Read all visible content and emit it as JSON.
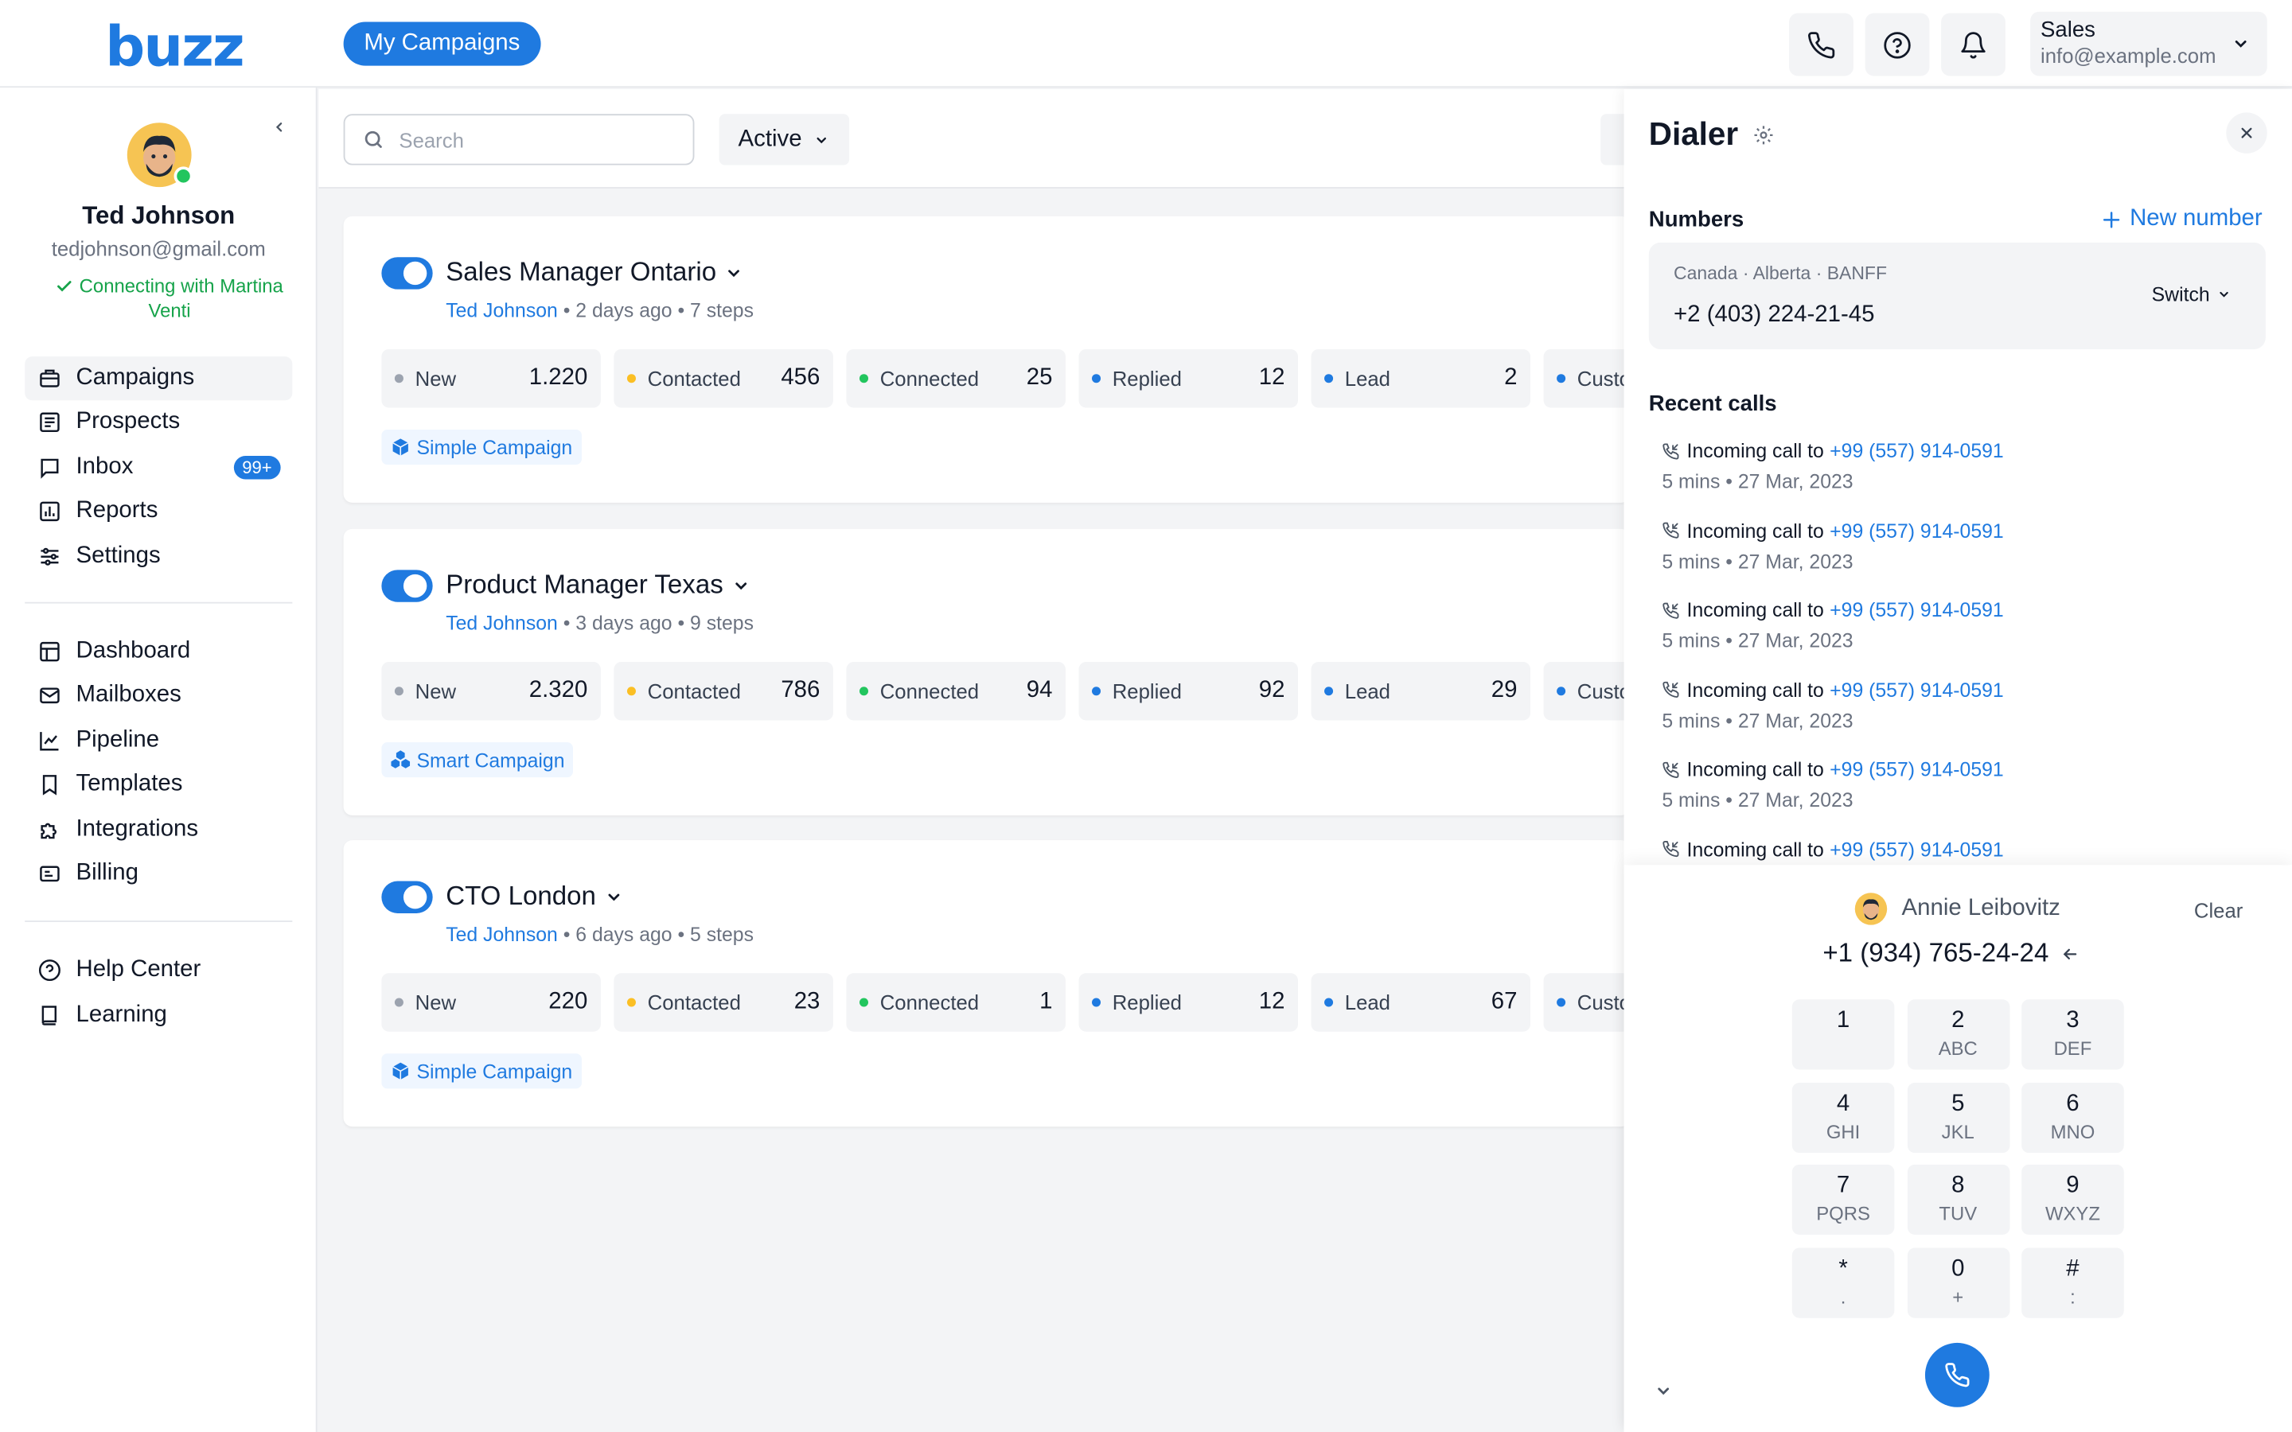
{
  "header": {
    "logo": "buzz",
    "campaigns_pill": "My Campaigns",
    "account": {
      "name": "Sales",
      "email": "info@example.com"
    },
    "icons": [
      "phone-icon",
      "help-icon",
      "bell-icon",
      "chevron-down-icon"
    ]
  },
  "user": {
    "name": "Ted Johnson",
    "email": "tedjohnson@gmail.com",
    "status": "Connecting with Martina Venti"
  },
  "sidebar": {
    "primary": [
      {
        "label": "Campaigns",
        "icon": "campaigns-icon",
        "active": true
      },
      {
        "label": "Prospects",
        "icon": "prospects-icon"
      },
      {
        "label": "Inbox",
        "icon": "inbox-icon",
        "badge": "99+"
      },
      {
        "label": "Reports",
        "icon": "reports-icon"
      },
      {
        "label": "Settings",
        "icon": "settings-icon"
      }
    ],
    "secondary": [
      {
        "label": "Dashboard",
        "icon": "dashboard-icon"
      },
      {
        "label": "Mailboxes",
        "icon": "mail-icon"
      },
      {
        "label": "Pipeline",
        "icon": "pipeline-icon"
      },
      {
        "label": "Templates",
        "icon": "bookmark-icon"
      },
      {
        "label": "Integrations",
        "icon": "puzzle-icon"
      },
      {
        "label": "Billing",
        "icon": "billing-icon"
      }
    ],
    "tertiary": [
      {
        "label": "Help Center",
        "icon": "help-icon"
      },
      {
        "label": "Learning",
        "icon": "book-icon"
      }
    ]
  },
  "toolbar": {
    "search_placeholder": "Search",
    "filter": "Active"
  },
  "campaigns": [
    {
      "title": "Sales Manager Ontario",
      "owner": "Ted Johnson",
      "meta": " • 2 days ago • 7 steps",
      "stats": [
        {
          "label": "New",
          "value": "1.220",
          "color": "#9ca3af"
        },
        {
          "label": "Contacted",
          "value": "456",
          "color": "#fbbf24"
        },
        {
          "label": "Connected",
          "value": "25",
          "color": "#22c55e"
        },
        {
          "label": "Replied",
          "value": "12",
          "color": "#1f7ae0"
        },
        {
          "label": "Lead",
          "value": "2",
          "color": "#1f7ae0"
        },
        {
          "label": "Custo",
          "value": "",
          "color": "#1f7ae0"
        }
      ],
      "tag": "Simple Campaign",
      "tag_icon": "cube-icon"
    },
    {
      "title": "Product Manager Texas",
      "owner": "Ted Johnson",
      "meta": " • 3 days ago • 9 steps",
      "stats": [
        {
          "label": "New",
          "value": "2.320",
          "color": "#9ca3af"
        },
        {
          "label": "Contacted",
          "value": "786",
          "color": "#fbbf24"
        },
        {
          "label": "Connected",
          "value": "94",
          "color": "#22c55e"
        },
        {
          "label": "Replied",
          "value": "92",
          "color": "#1f7ae0"
        },
        {
          "label": "Lead",
          "value": "29",
          "color": "#1f7ae0"
        },
        {
          "label": "Custo",
          "value": "",
          "color": "#1f7ae0"
        }
      ],
      "tag": "Smart Campaign",
      "tag_icon": "cubes-icon"
    },
    {
      "title": "CTO London",
      "owner": "Ted Johnson",
      "meta": " • 6 days ago • 5 steps",
      "stats": [
        {
          "label": "New",
          "value": "220",
          "color": "#9ca3af"
        },
        {
          "label": "Contacted",
          "value": "23",
          "color": "#fbbf24"
        },
        {
          "label": "Connected",
          "value": "1",
          "color": "#22c55e"
        },
        {
          "label": "Replied",
          "value": "12",
          "color": "#1f7ae0"
        },
        {
          "label": "Lead",
          "value": "67",
          "color": "#1f7ae0"
        },
        {
          "label": "Custo",
          "value": "",
          "color": "#1f7ae0"
        }
      ],
      "tag": "Simple Campaign",
      "tag_icon": "cube-icon"
    }
  ],
  "dialer": {
    "title": "Dialer",
    "numbers_heading": "Numbers",
    "new_number": "New number",
    "number": {
      "location": "Canada · Alberta · BANFF",
      "value": "+2 (403) 224-21-45",
      "switch": "Switch"
    },
    "recent_heading": "Recent calls",
    "recent_calls": [
      {
        "text": "Incoming call to",
        "phone": "+99 (557) 914-0591",
        "when": "5 mins • 27 Mar, 2023"
      },
      {
        "text": "Incoming call to",
        "phone": "+99 (557) 914-0591",
        "when": "5 mins • 27 Mar, 2023"
      },
      {
        "text": "Incoming call to",
        "phone": "+99 (557) 914-0591",
        "when": "5 mins • 27 Mar, 2023"
      },
      {
        "text": "Incoming call to",
        "phone": "+99 (557) 914-0591",
        "when": "5 mins • 27 Mar, 2023"
      },
      {
        "text": "Incoming call to",
        "phone": "+99 (557) 914-0591",
        "when": "5 mins • 27 Mar, 2023"
      },
      {
        "text": "Incoming call to",
        "phone": "+99 (557) 914-0591",
        "when": ""
      }
    ],
    "contact": "Annie Leibovitz",
    "clear": "Clear",
    "dial_number": "+1 (934) 765-24-24",
    "keys": [
      {
        "d": "1",
        "s": ""
      },
      {
        "d": "2",
        "s": "ABC"
      },
      {
        "d": "3",
        "s": "DEF"
      },
      {
        "d": "4",
        "s": "GHI"
      },
      {
        "d": "5",
        "s": "JKL"
      },
      {
        "d": "6",
        "s": "MNO"
      },
      {
        "d": "7",
        "s": "PQRS"
      },
      {
        "d": "8",
        "s": "TUV"
      },
      {
        "d": "9",
        "s": "WXYZ"
      },
      {
        "d": "*",
        "s": "."
      },
      {
        "d": "0",
        "s": "+"
      },
      {
        "d": "#",
        "s": ":"
      }
    ]
  }
}
